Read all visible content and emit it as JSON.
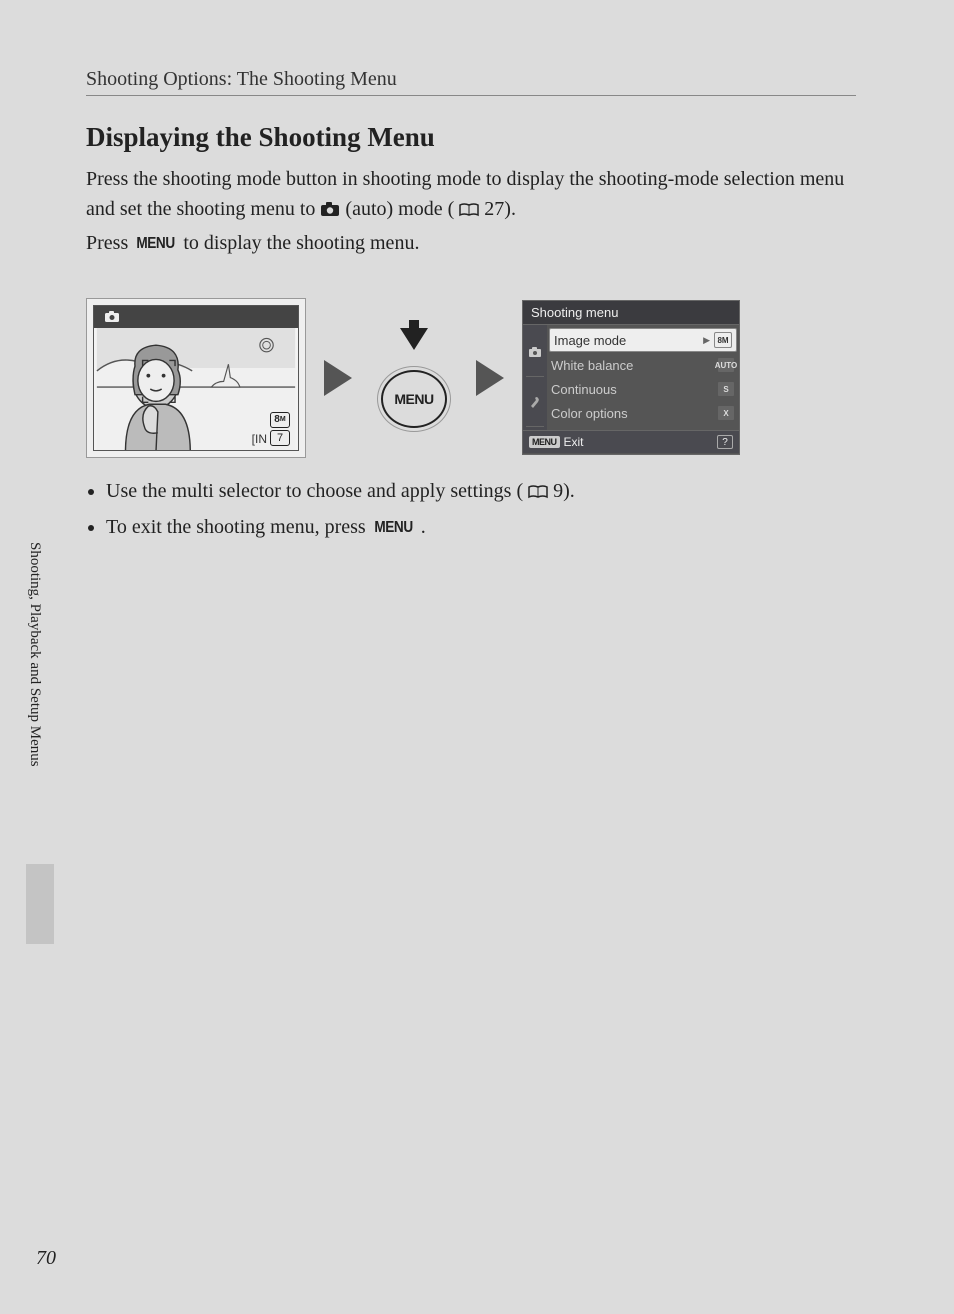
{
  "breadcrumb": "Shooting Options: The Shooting Menu",
  "title": "Displaying the Shooting Menu",
  "para1_a": "Press the shooting mode button in shooting mode to display the shooting-mode selection menu and set the shooting menu to ",
  "para1_b": " (auto) mode (",
  "para1_c": " 27).",
  "para2_a": "Press ",
  "para2_b": " to display the shooting menu.",
  "menu_word": "MENU",
  "lcd": {
    "badge_8m": "8",
    "badge_8m_sub": "M",
    "badge_7": "7",
    "badge_in": "IN"
  },
  "menu_btn_label": "MENU",
  "shooting_menu": {
    "header": "Shooting menu",
    "items": [
      {
        "label": "Image mode",
        "icon": "8M",
        "selected": true
      },
      {
        "label": "White balance",
        "icon": "AUTO",
        "selected": false
      },
      {
        "label": "Continuous",
        "icon": "S",
        "selected": false
      },
      {
        "label": "Color options",
        "icon": "X",
        "selected": false
      }
    ],
    "footer_tag": "MENU",
    "footer_exit": "Exit",
    "footer_help": "?"
  },
  "bullets": [
    {
      "a": "Use the multi selector to choose and apply settings (",
      "b": " 9)."
    },
    {
      "a": "To exit the shooting menu, press ",
      "b": "."
    }
  ],
  "side_text": "Shooting, Playback and Setup Menus",
  "page_number": "70"
}
